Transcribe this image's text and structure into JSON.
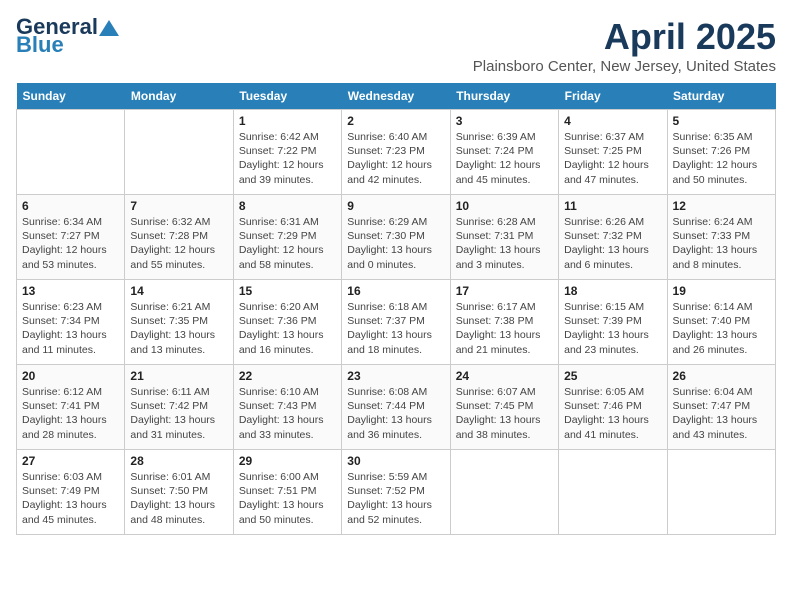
{
  "header": {
    "logo_general": "General",
    "logo_blue": "Blue",
    "month_title": "April 2025",
    "location": "Plainsboro Center, New Jersey, United States"
  },
  "weekdays": [
    "Sunday",
    "Monday",
    "Tuesday",
    "Wednesday",
    "Thursday",
    "Friday",
    "Saturday"
  ],
  "weeks": [
    [
      null,
      null,
      {
        "day": "1",
        "sunrise": "Sunrise: 6:42 AM",
        "sunset": "Sunset: 7:22 PM",
        "daylight": "Daylight: 12 hours and 39 minutes."
      },
      {
        "day": "2",
        "sunrise": "Sunrise: 6:40 AM",
        "sunset": "Sunset: 7:23 PM",
        "daylight": "Daylight: 12 hours and 42 minutes."
      },
      {
        "day": "3",
        "sunrise": "Sunrise: 6:39 AM",
        "sunset": "Sunset: 7:24 PM",
        "daylight": "Daylight: 12 hours and 45 minutes."
      },
      {
        "day": "4",
        "sunrise": "Sunrise: 6:37 AM",
        "sunset": "Sunset: 7:25 PM",
        "daylight": "Daylight: 12 hours and 47 minutes."
      },
      {
        "day": "5",
        "sunrise": "Sunrise: 6:35 AM",
        "sunset": "Sunset: 7:26 PM",
        "daylight": "Daylight: 12 hours and 50 minutes."
      }
    ],
    [
      {
        "day": "6",
        "sunrise": "Sunrise: 6:34 AM",
        "sunset": "Sunset: 7:27 PM",
        "daylight": "Daylight: 12 hours and 53 minutes."
      },
      {
        "day": "7",
        "sunrise": "Sunrise: 6:32 AM",
        "sunset": "Sunset: 7:28 PM",
        "daylight": "Daylight: 12 hours and 55 minutes."
      },
      {
        "day": "8",
        "sunrise": "Sunrise: 6:31 AM",
        "sunset": "Sunset: 7:29 PM",
        "daylight": "Daylight: 12 hours and 58 minutes."
      },
      {
        "day": "9",
        "sunrise": "Sunrise: 6:29 AM",
        "sunset": "Sunset: 7:30 PM",
        "daylight": "Daylight: 13 hours and 0 minutes."
      },
      {
        "day": "10",
        "sunrise": "Sunrise: 6:28 AM",
        "sunset": "Sunset: 7:31 PM",
        "daylight": "Daylight: 13 hours and 3 minutes."
      },
      {
        "day": "11",
        "sunrise": "Sunrise: 6:26 AM",
        "sunset": "Sunset: 7:32 PM",
        "daylight": "Daylight: 13 hours and 6 minutes."
      },
      {
        "day": "12",
        "sunrise": "Sunrise: 6:24 AM",
        "sunset": "Sunset: 7:33 PM",
        "daylight": "Daylight: 13 hours and 8 minutes."
      }
    ],
    [
      {
        "day": "13",
        "sunrise": "Sunrise: 6:23 AM",
        "sunset": "Sunset: 7:34 PM",
        "daylight": "Daylight: 13 hours and 11 minutes."
      },
      {
        "day": "14",
        "sunrise": "Sunrise: 6:21 AM",
        "sunset": "Sunset: 7:35 PM",
        "daylight": "Daylight: 13 hours and 13 minutes."
      },
      {
        "day": "15",
        "sunrise": "Sunrise: 6:20 AM",
        "sunset": "Sunset: 7:36 PM",
        "daylight": "Daylight: 13 hours and 16 minutes."
      },
      {
        "day": "16",
        "sunrise": "Sunrise: 6:18 AM",
        "sunset": "Sunset: 7:37 PM",
        "daylight": "Daylight: 13 hours and 18 minutes."
      },
      {
        "day": "17",
        "sunrise": "Sunrise: 6:17 AM",
        "sunset": "Sunset: 7:38 PM",
        "daylight": "Daylight: 13 hours and 21 minutes."
      },
      {
        "day": "18",
        "sunrise": "Sunrise: 6:15 AM",
        "sunset": "Sunset: 7:39 PM",
        "daylight": "Daylight: 13 hours and 23 minutes."
      },
      {
        "day": "19",
        "sunrise": "Sunrise: 6:14 AM",
        "sunset": "Sunset: 7:40 PM",
        "daylight": "Daylight: 13 hours and 26 minutes."
      }
    ],
    [
      {
        "day": "20",
        "sunrise": "Sunrise: 6:12 AM",
        "sunset": "Sunset: 7:41 PM",
        "daylight": "Daylight: 13 hours and 28 minutes."
      },
      {
        "day": "21",
        "sunrise": "Sunrise: 6:11 AM",
        "sunset": "Sunset: 7:42 PM",
        "daylight": "Daylight: 13 hours and 31 minutes."
      },
      {
        "day": "22",
        "sunrise": "Sunrise: 6:10 AM",
        "sunset": "Sunset: 7:43 PM",
        "daylight": "Daylight: 13 hours and 33 minutes."
      },
      {
        "day": "23",
        "sunrise": "Sunrise: 6:08 AM",
        "sunset": "Sunset: 7:44 PM",
        "daylight": "Daylight: 13 hours and 36 minutes."
      },
      {
        "day": "24",
        "sunrise": "Sunrise: 6:07 AM",
        "sunset": "Sunset: 7:45 PM",
        "daylight": "Daylight: 13 hours and 38 minutes."
      },
      {
        "day": "25",
        "sunrise": "Sunrise: 6:05 AM",
        "sunset": "Sunset: 7:46 PM",
        "daylight": "Daylight: 13 hours and 41 minutes."
      },
      {
        "day": "26",
        "sunrise": "Sunrise: 6:04 AM",
        "sunset": "Sunset: 7:47 PM",
        "daylight": "Daylight: 13 hours and 43 minutes."
      }
    ],
    [
      {
        "day": "27",
        "sunrise": "Sunrise: 6:03 AM",
        "sunset": "Sunset: 7:49 PM",
        "daylight": "Daylight: 13 hours and 45 minutes."
      },
      {
        "day": "28",
        "sunrise": "Sunrise: 6:01 AM",
        "sunset": "Sunset: 7:50 PM",
        "daylight": "Daylight: 13 hours and 48 minutes."
      },
      {
        "day": "29",
        "sunrise": "Sunrise: 6:00 AM",
        "sunset": "Sunset: 7:51 PM",
        "daylight": "Daylight: 13 hours and 50 minutes."
      },
      {
        "day": "30",
        "sunrise": "Sunrise: 5:59 AM",
        "sunset": "Sunset: 7:52 PM",
        "daylight": "Daylight: 13 hours and 52 minutes."
      },
      null,
      null,
      null
    ]
  ]
}
